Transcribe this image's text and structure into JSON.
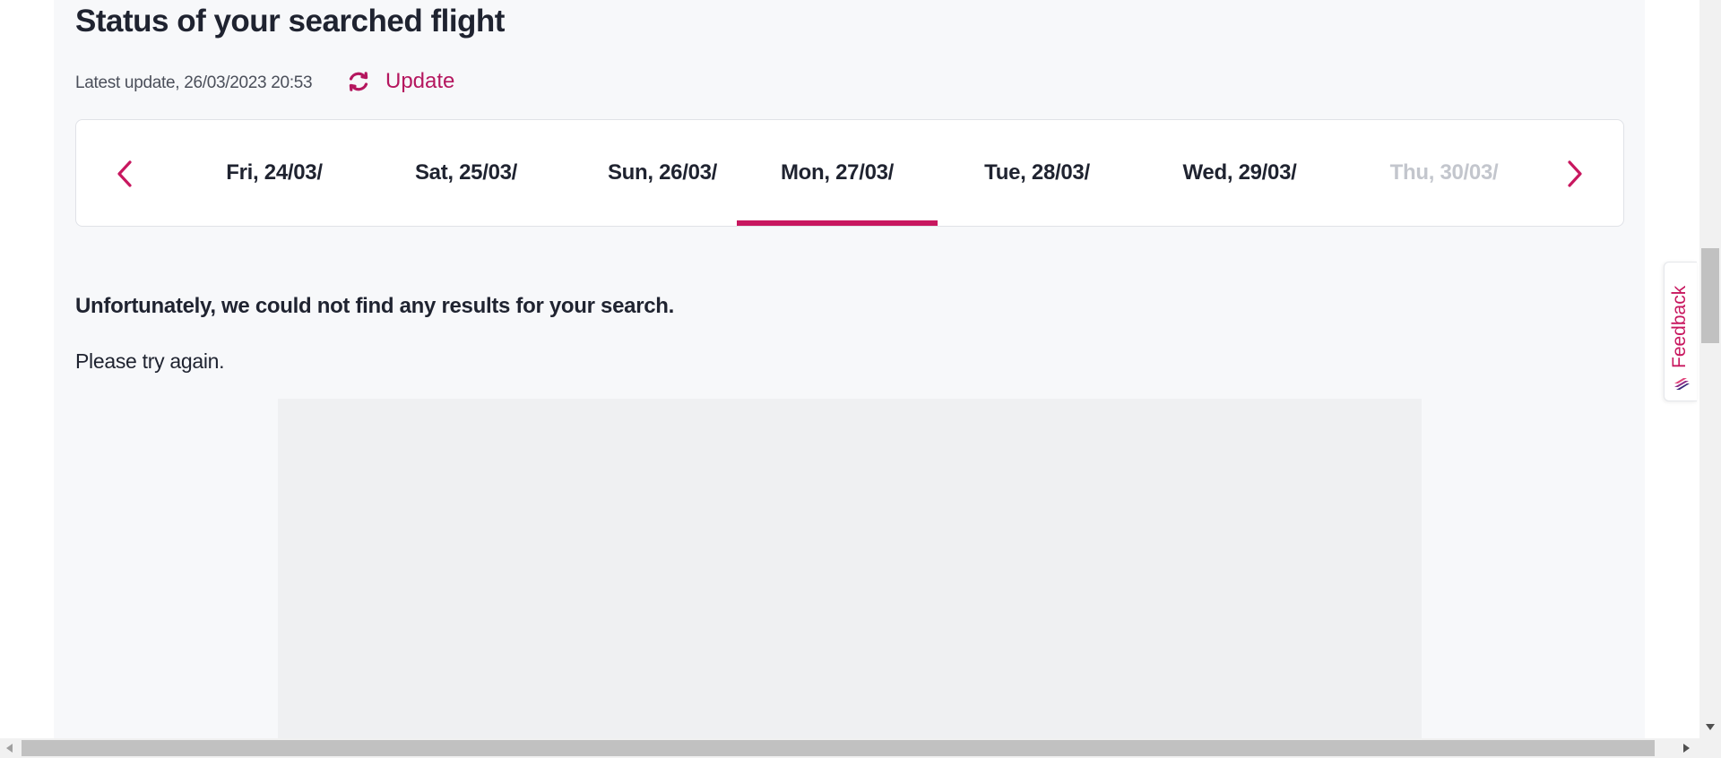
{
  "header": {
    "title": "Status of your searched flight",
    "latest_update": "Latest update, 26/03/2023 20:53",
    "update_label": "Update"
  },
  "date_nav": {
    "dates": [
      {
        "label": "Fri, 24/03/",
        "state": "normal"
      },
      {
        "label": "Sat, 25/03/",
        "state": "normal"
      },
      {
        "label": "Sun, 26/03/",
        "state": "normal"
      },
      {
        "label": "Mon, 27/03/",
        "state": "active"
      },
      {
        "label": "Tue, 28/03/",
        "state": "normal"
      },
      {
        "label": "Wed, 29/03/",
        "state": "normal"
      },
      {
        "label": "Thu, 30/03/",
        "state": "disabled"
      }
    ],
    "prev_icon": "chevron-left-icon",
    "next_icon": "chevron-right-icon"
  },
  "results": {
    "empty_title": "Unfortunately, we could not find any results for your search.",
    "empty_message": "Please try again."
  },
  "feedback": {
    "label": "Feedback"
  },
  "colors": {
    "accent": "#c8175f",
    "text": "#1f2330",
    "disabled_text": "#c3c6cd",
    "panel_bg": "#f7f8fa"
  }
}
